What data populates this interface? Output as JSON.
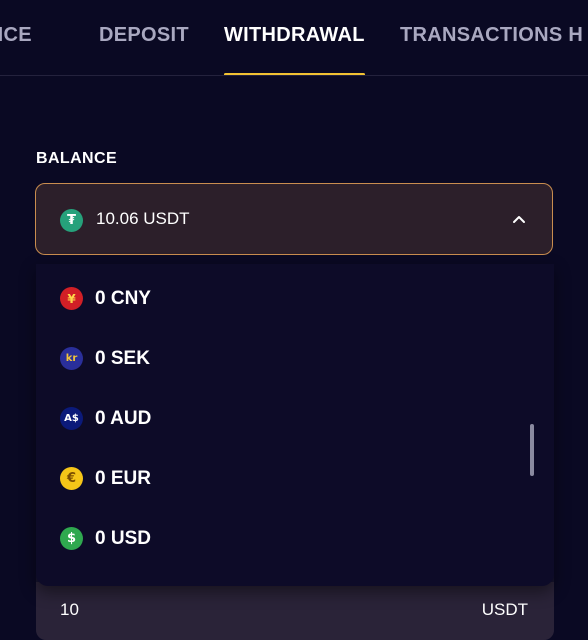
{
  "tabs": [
    {
      "label": "BALANCE",
      "visible_text": "ANCE"
    },
    {
      "label": "DEPOSIT"
    },
    {
      "label": "WITHDRAWAL",
      "active": true
    },
    {
      "label": "TRANSACTIONS H"
    }
  ],
  "section": {
    "label": "BALANCE"
  },
  "selected": {
    "text": "10.06 USDT",
    "icon": "tether-usdt-icon"
  },
  "options": [
    {
      "label": "0 CNY",
      "icon": "yuan-icon",
      "glyph": "¥"
    },
    {
      "label": "0 SEK",
      "icon": "krona-icon",
      "glyph": "kr"
    },
    {
      "label": "0 AUD",
      "icon": "aud-icon",
      "glyph": "A$"
    },
    {
      "label": "0 EUR",
      "icon": "euro-icon",
      "glyph": "€"
    },
    {
      "label": "0 USD",
      "icon": "dollar-icon",
      "glyph": "$"
    }
  ],
  "amount": {
    "value": "10",
    "unit": "USDT"
  },
  "colors": {
    "background": "#0a0923",
    "accent": "#f2c233",
    "select_border": "#c98d4f",
    "usdt": "#26a17b"
  }
}
